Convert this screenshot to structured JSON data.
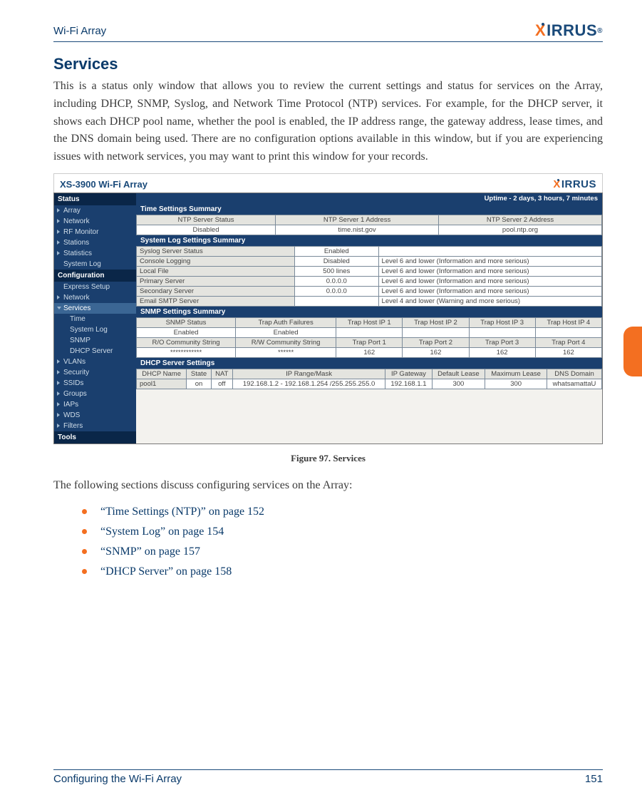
{
  "header": {
    "doc_title": "Wi-Fi Array",
    "logo_text": "XIRRUS"
  },
  "section": {
    "heading": "Services",
    "intro": "This is a status only window that allows you to review the current settings and status for services on the Array, including DHCP, SNMP, Syslog, and Network Time Protocol (NTP) services. For example, for the DHCP server, it shows each DHCP pool name, whether the pool is enabled, the IP address range, the gateway address, lease times, and the DNS domain being used. There are no configuration options available in this window, but if you are experiencing issues with network services, you may want to print this window for your records.",
    "figure_caption": "Figure 97. Services",
    "followup": "The following sections discuss configuring services on the Array:"
  },
  "links": [
    "“Time Settings (NTP)” on page 152",
    "“System Log” on page 154",
    "“SNMP” on page 157",
    "“DHCP Server” on page 158"
  ],
  "footer": {
    "section_label": "Configuring the Wi-Fi Array",
    "page": "151"
  },
  "screenshot": {
    "app_title": "XS-3900 Wi-Fi Array",
    "uptime": "Uptime - 2 days, 3 hours, 7 minutes",
    "sidebar": {
      "sections": [
        {
          "head": "Status",
          "items": [
            "Array",
            "Network",
            "RF Monitor",
            "Stations",
            "Statistics",
            "System Log"
          ]
        },
        {
          "head": "Configuration",
          "items": [
            "Express Setup",
            "Network"
          ],
          "servicesLabel": "Services",
          "serviceSubs": [
            "Time",
            "System Log",
            "SNMP",
            "DHCP Server"
          ],
          "more": [
            "VLANs",
            "Security",
            "SSIDs",
            "Groups",
            "IAPs",
            "WDS",
            "Filters"
          ]
        },
        {
          "head": "Tools",
          "items": []
        }
      ]
    },
    "time_settings": {
      "title": "Time Settings Summary",
      "headers": [
        "NTP Server Status",
        "NTP Server 1 Address",
        "NTP Server 2 Address"
      ],
      "row": [
        "Disabled",
        "time.nist.gov",
        "pool.ntp.org"
      ]
    },
    "syslog": {
      "title": "System Log Settings Summary",
      "rows": [
        {
          "label": "Syslog Server Status",
          "value": "Enabled",
          "note": ""
        },
        {
          "label": "Console Logging",
          "value": "Disabled",
          "note": "Level 6 and lower (Information and more serious)"
        },
        {
          "label": "Local File",
          "value": "500 lines",
          "note": "Level 6 and lower (Information and more serious)"
        },
        {
          "label": "Primary Server",
          "value": "0.0.0.0",
          "note": "Level 6 and lower (Information and more serious)"
        },
        {
          "label": "Secondary Server",
          "value": "0.0.0.0",
          "note": "Level 6 and lower (Information and more serious)"
        },
        {
          "label": "Email SMTP Server",
          "value": "",
          "note": "Level 4 and lower (Warning and more serious)"
        }
      ]
    },
    "snmp": {
      "title": "SNMP Settings Summary",
      "row1_headers": [
        "SNMP Status",
        "Trap Auth Failures",
        "Trap Host IP 1",
        "Trap Host IP 2",
        "Trap Host IP 3",
        "Trap Host IP 4"
      ],
      "row1_values": [
        "Enabled",
        "Enabled",
        "",
        "",
        "",
        ""
      ],
      "row2_headers": [
        "R/O Community String",
        "R/W Community String",
        "Trap Port 1",
        "Trap Port 2",
        "Trap Port 3",
        "Trap Port 4"
      ],
      "row2_values": [
        "************",
        "******",
        "162",
        "162",
        "162",
        "162"
      ]
    },
    "dhcp": {
      "title": "DHCP Server Settings",
      "headers": [
        "DHCP Name",
        "State",
        "NAT",
        "IP Range/Mask",
        "IP Gateway",
        "Default Lease",
        "Maximum Lease",
        "DNS Domain"
      ],
      "row": [
        "pool1",
        "on",
        "off",
        "192.168.1.2 - 192.168.1.254 /255.255.255.0",
        "192.168.1.1",
        "300",
        "300",
        "whatsamattaU"
      ]
    }
  }
}
